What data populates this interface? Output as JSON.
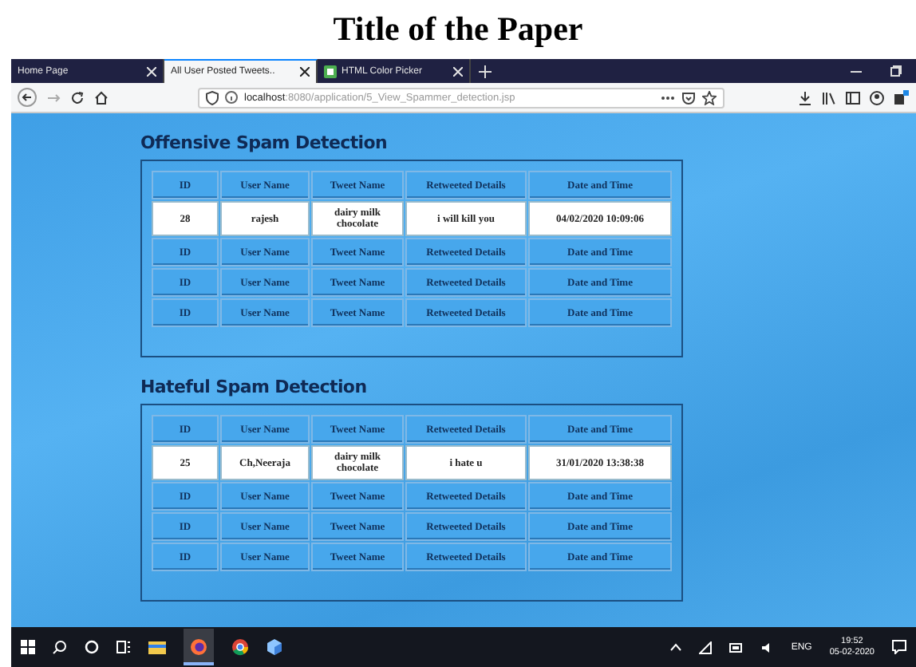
{
  "figure_title": "Title of the Paper",
  "browser": {
    "tabs": [
      {
        "label": "Home Page",
        "selected": false,
        "icon": false
      },
      {
        "label": "All User Posted Tweets..",
        "selected": true,
        "icon": false
      },
      {
        "label": "HTML Color Picker",
        "selected": false,
        "icon": true
      }
    ],
    "url": {
      "host": "localhost",
      "rest": ":8080/application/5_View_Spammer_detection.jsp"
    }
  },
  "sections": [
    {
      "heading": "Offensive Spam Detection",
      "rows": [
        {
          "kind": "header",
          "cells": [
            "ID",
            "User Name",
            "Tweet Name",
            "Retweeted Details",
            "Date and Time"
          ]
        },
        {
          "kind": "data",
          "cells": [
            "28",
            "rajesh",
            "dairy milk chocolate",
            "i will kill you",
            "04/02/2020 10:09:06"
          ]
        },
        {
          "kind": "header",
          "cells": [
            "ID",
            "User Name",
            "Tweet Name",
            "Retweeted Details",
            "Date and Time"
          ]
        },
        {
          "kind": "header",
          "cells": [
            "ID",
            "User Name",
            "Tweet Name",
            "Retweeted Details",
            "Date and Time"
          ]
        },
        {
          "kind": "header",
          "cells": [
            "ID",
            "User Name",
            "Tweet Name",
            "Retweeted Details",
            "Date and Time"
          ]
        }
      ]
    },
    {
      "heading": "Hateful Spam Detection",
      "rows": [
        {
          "kind": "header",
          "cells": [
            "ID",
            "User Name",
            "Tweet Name",
            "Retweeted Details",
            "Date and Time"
          ]
        },
        {
          "kind": "data",
          "cells": [
            "25",
            "Ch,Neeraja",
            "dairy milk chocolate",
            "i hate u",
            "31/01/2020 13:38:38"
          ]
        },
        {
          "kind": "header",
          "cells": [
            "ID",
            "User Name",
            "Tweet Name",
            "Retweeted Details",
            "Date and Time"
          ]
        },
        {
          "kind": "header",
          "cells": [
            "ID",
            "User Name",
            "Tweet Name",
            "Retweeted Details",
            "Date and Time"
          ]
        },
        {
          "kind": "header",
          "cells": [
            "ID",
            "User Name",
            "Tweet Name",
            "Retweeted Details",
            "Date and Time"
          ]
        }
      ]
    }
  ],
  "taskbar": {
    "language": "ENG",
    "time": "19:52",
    "date": "05-02-2020"
  }
}
